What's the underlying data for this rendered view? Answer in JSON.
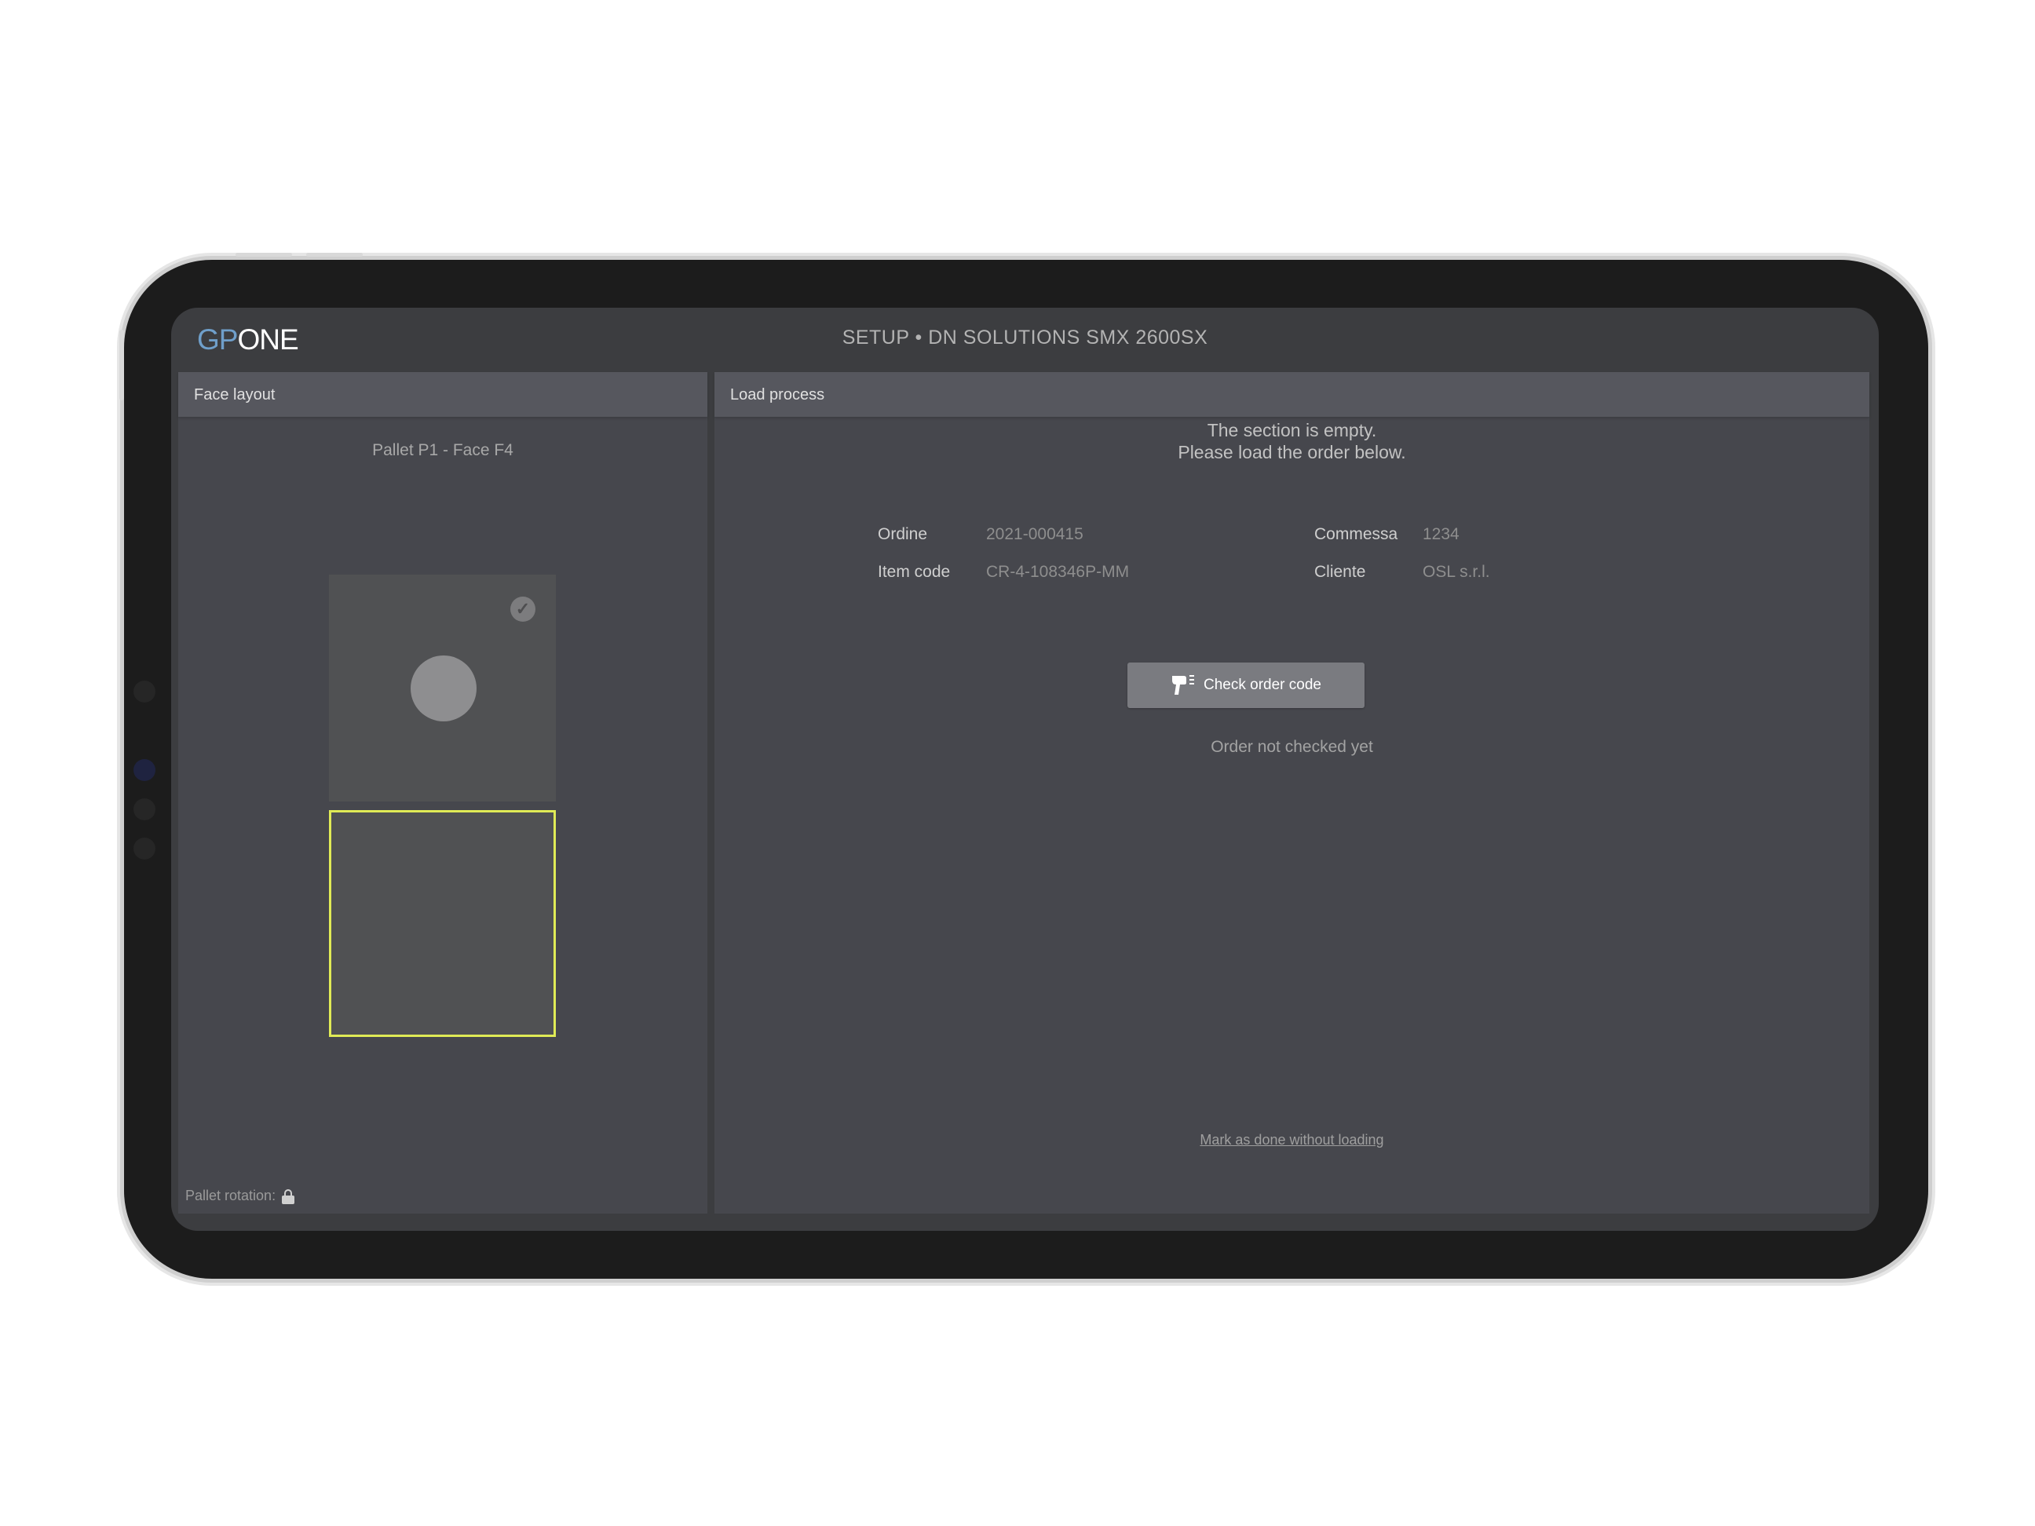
{
  "app": {
    "logo_gp": "GP",
    "logo_one": "ONE",
    "title": "SETUP • DN SOLUTIONS SMX 2600SX"
  },
  "face_layout": {
    "header": "Face layout",
    "pallet_label": "Pallet P1 - Face F4",
    "pallet_rotation_label": "Pallet rotation:",
    "highlight_color": "#e0eb56"
  },
  "load_process": {
    "header": "Load process",
    "empty_line1": "The section is empty.",
    "empty_line2": "Please load the order below.",
    "fields": {
      "ordine_label": "Ordine",
      "ordine_value": "2021-000415",
      "item_code_label": "Item code",
      "item_code_value": "CR-4-108346P-MM",
      "commessa_label": "Commessa",
      "commessa_value": "1234",
      "cliente_label": "Cliente",
      "cliente_value": "OSL s.r.l."
    },
    "check_button_label": "Check order code",
    "check_button_icon": "barcode-scanner-icon",
    "status_text": "Order not checked yet",
    "mark_done_link": "Mark as done without loading"
  }
}
